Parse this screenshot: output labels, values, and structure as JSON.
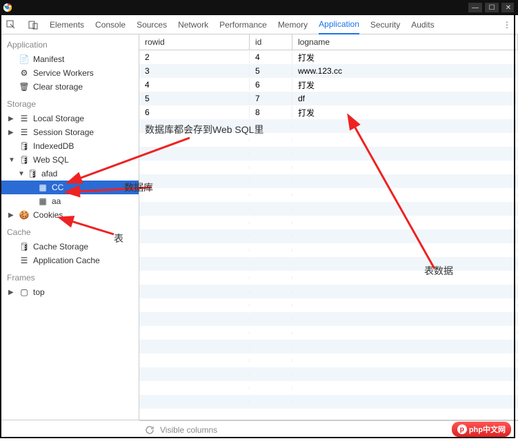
{
  "tabs": {
    "elements": "Elements",
    "console": "Console",
    "sources": "Sources",
    "network": "Network",
    "performance": "Performance",
    "memory": "Memory",
    "application": "Application",
    "security": "Security",
    "audits": "Audits"
  },
  "sidebar": {
    "sections": {
      "application": "Application",
      "storage": "Storage",
      "cache": "Cache",
      "frames": "Frames"
    },
    "items": {
      "manifest": "Manifest",
      "service_workers": "Service Workers",
      "clear_storage": "Clear storage",
      "local_storage": "Local Storage",
      "session_storage": "Session Storage",
      "indexeddb": "IndexedDB",
      "web_sql": "Web SQL",
      "db_afad": "afad",
      "tbl_cc": "CC",
      "tbl_aa": "aa",
      "cookies": "Cookies",
      "cache_storage": "Cache Storage",
      "app_cache": "Application Cache",
      "top": "top"
    }
  },
  "table": {
    "columns": {
      "rowid": "rowid",
      "id": "id",
      "logname": "logname"
    },
    "rows": [
      {
        "rowid": "2",
        "id": "4",
        "logname": "打发"
      },
      {
        "rowid": "3",
        "id": "5",
        "logname": "www.123.cc"
      },
      {
        "rowid": "4",
        "id": "6",
        "logname": "打发"
      },
      {
        "rowid": "5",
        "id": "7",
        "logname": "df"
      },
      {
        "rowid": "6",
        "id": "8",
        "logname": "打发"
      }
    ]
  },
  "bottombar": {
    "visible_columns": "Visible columns"
  },
  "annotations": {
    "storage_note": "数据库都会存到Web SQL里",
    "database_note": "数据库",
    "table_note": "表",
    "tabledata_note": "表数据"
  },
  "watermark": "php中文网"
}
